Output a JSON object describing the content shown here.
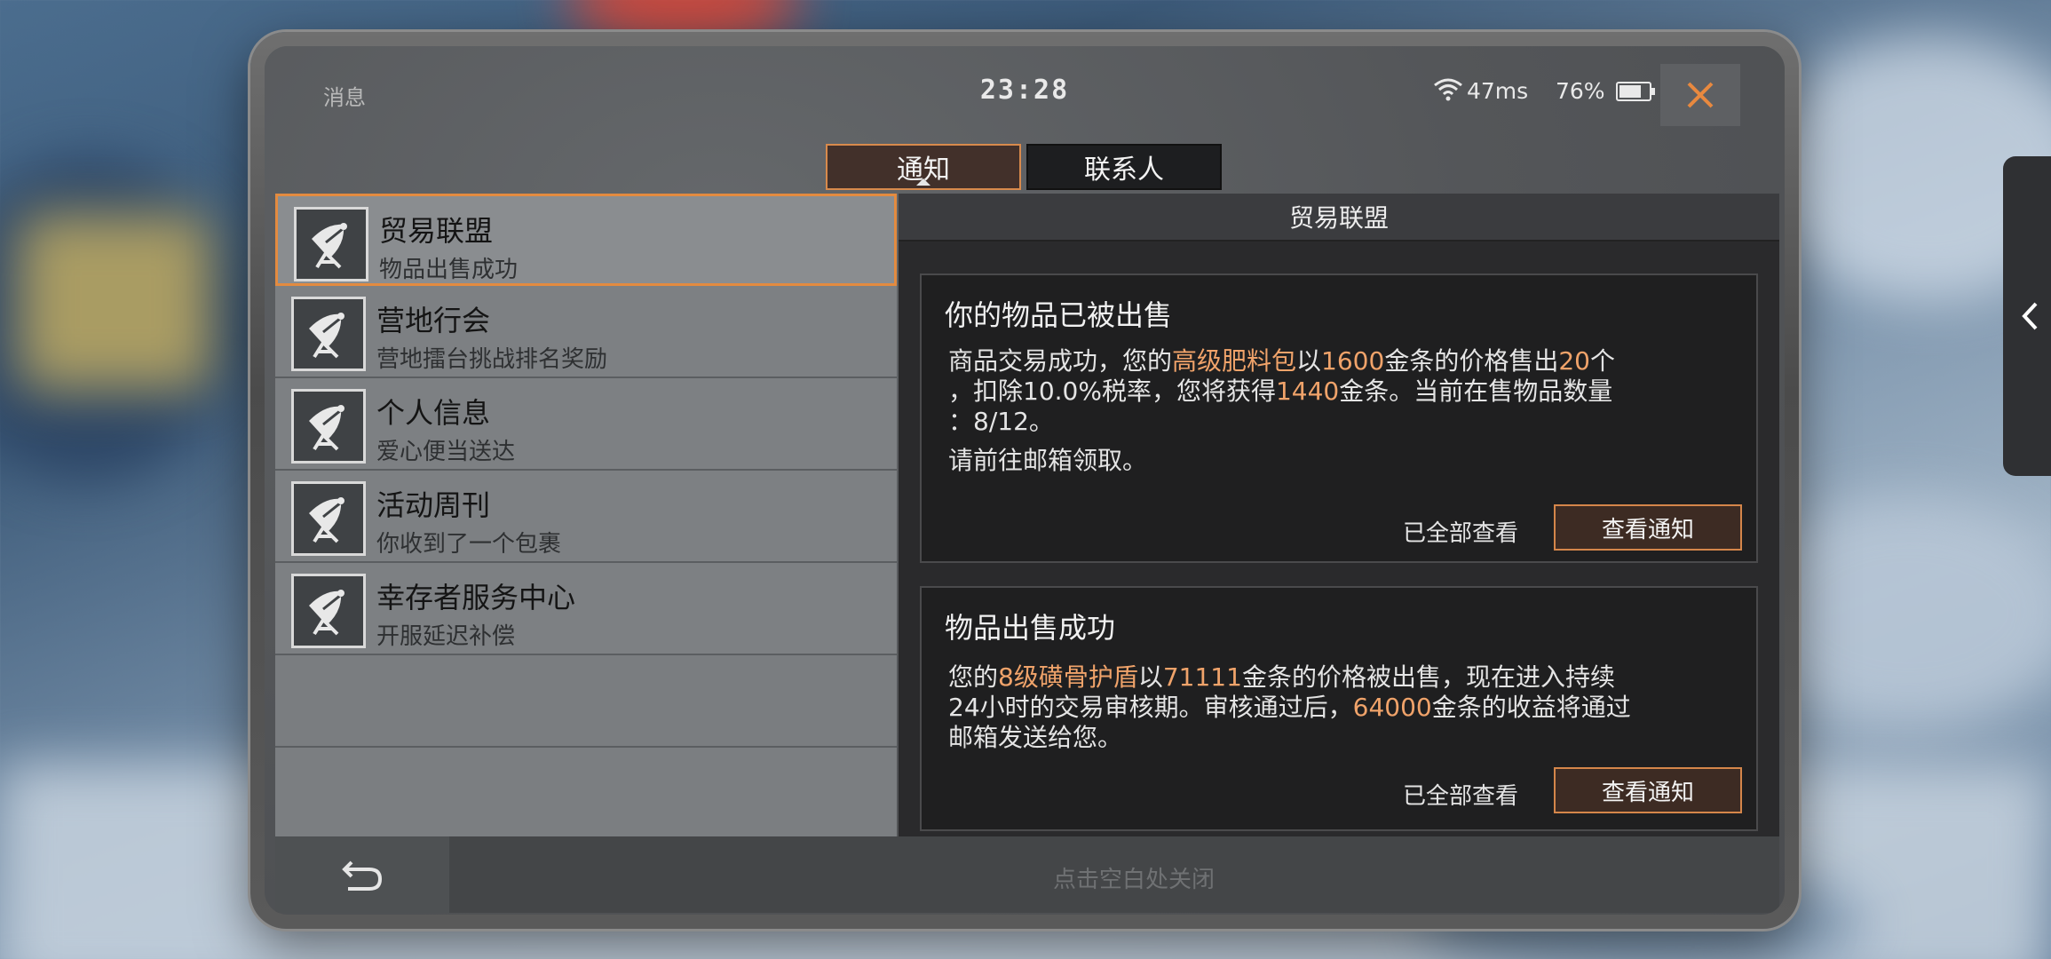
{
  "status": {
    "app_title": "消息",
    "time": "23:28",
    "ping": "47ms",
    "battery_percent": "76%",
    "battery_level": 0.76
  },
  "tabs": [
    {
      "label": "通知",
      "active": true
    },
    {
      "label": "联系人",
      "active": false
    }
  ],
  "list": {
    "items": [
      {
        "title": "贸易联盟",
        "subtitle": "物品出售成功",
        "selected": true
      },
      {
        "title": "营地行会",
        "subtitle": "营地擂台挑战排名奖励"
      },
      {
        "title": "个人信息",
        "subtitle": "爱心便当送达"
      },
      {
        "title": "活动周刊",
        "subtitle": "你收到了一个包裹"
      },
      {
        "title": "幸存者服务中心",
        "subtitle": "开服延迟补偿"
      }
    ]
  },
  "detail": {
    "header": "贸易联盟",
    "cards": [
      {
        "title": "你的物品已被出售",
        "line1_prefix": "商品交易成功，您的",
        "line1_item": "高级肥料包",
        "line1_mid": "以",
        "line1_price": "1600",
        "line1_mid2": "金条的价格售出",
        "line1_qty": "20",
        "line1_suffix": "个",
        "line2_prefix": "，扣除10.0%税率，您将获得",
        "line2_amount": "1440",
        "line2_suffix": "金条。当前在售物品数量",
        "line3": "：8/12。",
        "line4": "请前往邮箱领取。",
        "read_label": "已全部查看",
        "button_label": "查看通知"
      },
      {
        "title": "物品出售成功",
        "line1_prefix": "您的",
        "line1_item": "8级磺骨护盾",
        "line1_mid": "以",
        "line1_price": "71111",
        "line1_suffix": "金条的价格被出售，现在进入持续",
        "line2_prefix": "24小时的交易审核期。审核通过后，",
        "line2_amount": "64000",
        "line2_suffix": "金条的收益将通过",
        "line3": "邮箱发送给您。",
        "read_label": "已全部查看",
        "button_label": "查看通知"
      }
    ]
  },
  "footer": {
    "hint": "点击空白处关闭"
  },
  "colors": {
    "accent": "#e38b40",
    "highlight": "#f0a36a"
  }
}
